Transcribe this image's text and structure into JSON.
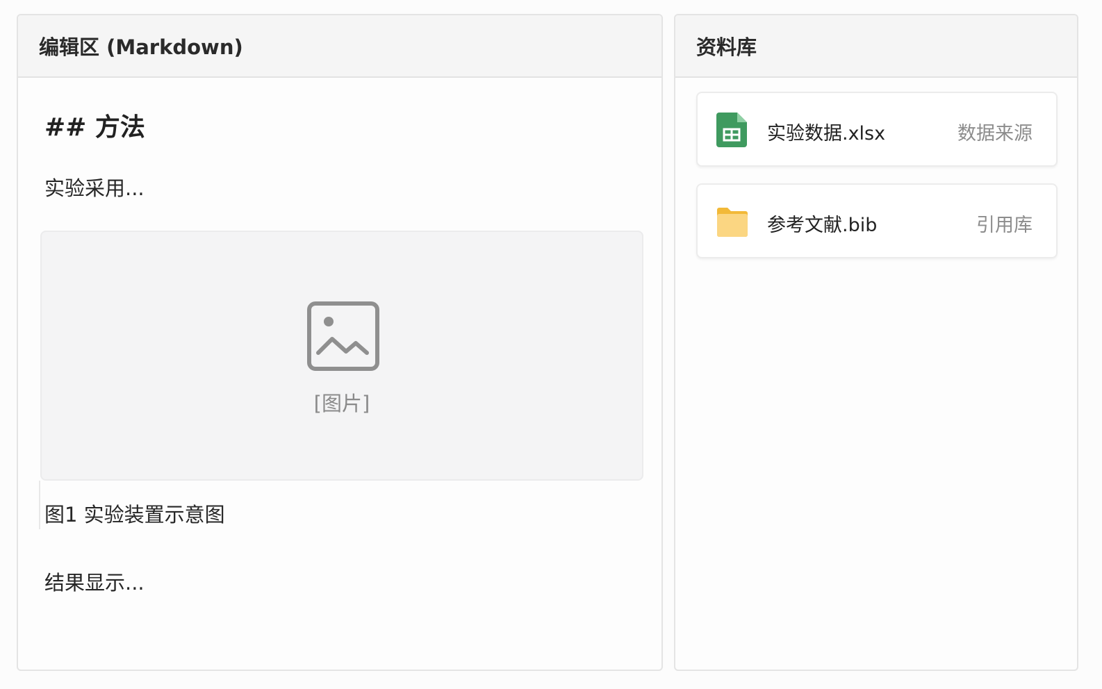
{
  "editor": {
    "title": "编辑区 (Markdown)",
    "heading": "## 方法",
    "paragraph1": "实验采用...",
    "image_placeholder": "[图片]",
    "caption": "图1  实验装置示意图",
    "paragraph2": "结果显示..."
  },
  "library": {
    "title": "资料库",
    "items": [
      {
        "name": "实验数据.xlsx",
        "tag": "数据来源",
        "icon": "spreadsheet-icon",
        "color": "#3f9a5f"
      },
      {
        "name": "参考文献.bib",
        "tag": "引用库",
        "icon": "folder-icon",
        "color": "#f5c35a"
      }
    ]
  }
}
